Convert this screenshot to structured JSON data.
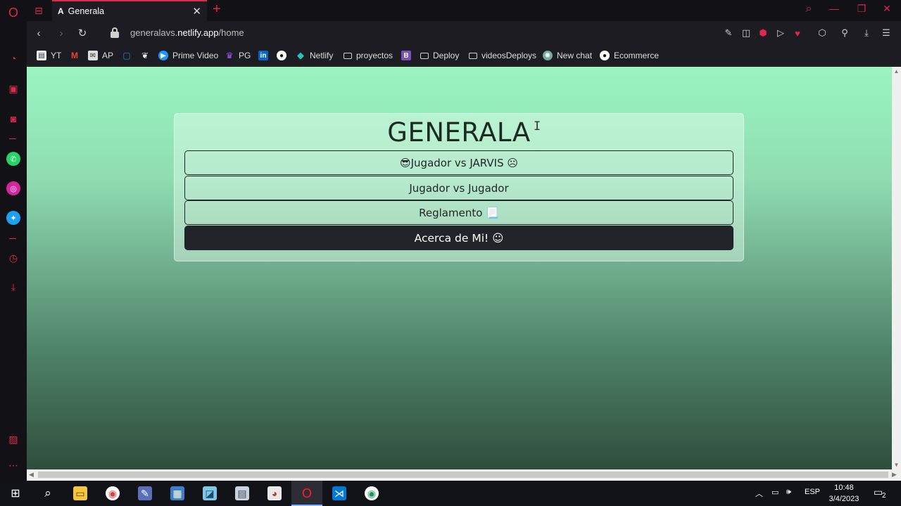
{
  "window": {
    "tab_title": "Generala",
    "tab_favicon": "A",
    "close_glyph": "✕",
    "newtab_glyph": "+",
    "accent": "#e0274e"
  },
  "address": {
    "url_prefix": "generalavs.",
    "url_domain": "netlify.app",
    "url_path": "/home"
  },
  "bookmarks": [
    {
      "label": "YT",
      "icon": "page-icon"
    },
    {
      "label": "",
      "icon": "gmail-icon"
    },
    {
      "label": "AP",
      "icon": "mail-icon"
    },
    {
      "label": "",
      "icon": "tv-icon"
    },
    {
      "label": "",
      "icon": "fox-icon"
    },
    {
      "label": "Prime Video",
      "icon": "prime-icon"
    },
    {
      "label": "PG",
      "icon": "crown-icon"
    },
    {
      "label": "",
      "icon": "linkedin-icon"
    },
    {
      "label": "",
      "icon": "github-icon"
    },
    {
      "label": "Netlify",
      "icon": "netlify-icon"
    },
    {
      "label": "proyectos",
      "icon": "folder-icon"
    },
    {
      "label": "",
      "icon": "bootstrap-icon"
    },
    {
      "label": "Deploy",
      "icon": "folder-icon"
    },
    {
      "label": "videosDeploys",
      "icon": "folder-icon"
    },
    {
      "label": "New chat",
      "icon": "chatgpt-icon"
    },
    {
      "label": "Ecommerce",
      "icon": "github-icon"
    }
  ],
  "page": {
    "title": "GENERALA",
    "cursor": "I",
    "buttons": [
      {
        "label": "😎Jugador vs JARVIS ☹"
      },
      {
        "label": "Jugador vs Jugador"
      },
      {
        "label": "Reglamento 📃"
      },
      {
        "label": "Acerca de Mi! ☺"
      }
    ]
  },
  "taskbar": {
    "language": "ESP",
    "time": "10:48",
    "date": "3/4/2023",
    "notification_count": "2"
  }
}
